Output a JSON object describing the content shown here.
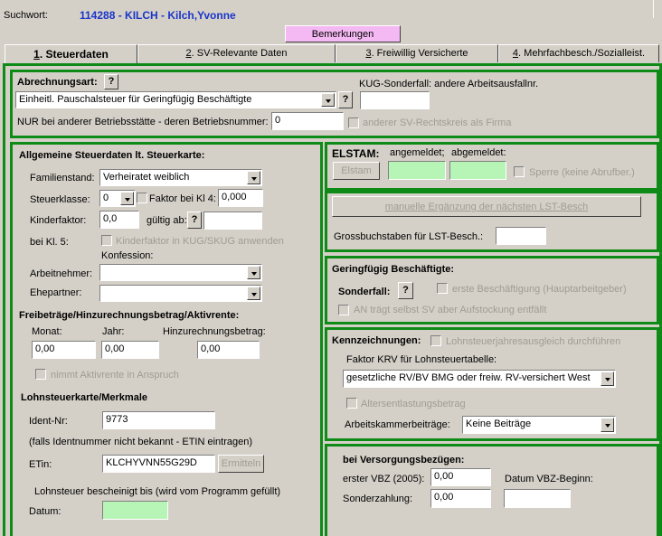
{
  "header": {
    "suchwort_label": "Suchwort:",
    "suchwort_value": "114288 - KILCH - Kilch,Yvonne",
    "bemerkungen": "Bemerkungen"
  },
  "tabs": [
    {
      "num": "1",
      "label": ". Steuerdaten"
    },
    {
      "num": "2",
      "label": ". SV-Relevante Daten"
    },
    {
      "num": "3",
      "label": ". Freiwillig Versicherte"
    },
    {
      "num": "4",
      "label": ". Mehrfachbesch./Sozialleist."
    }
  ],
  "abrechnung": {
    "title": "Abrechnungsart:",
    "help": "?",
    "select_value": "Einheitl. Pauschalsteuer für Geringfügig Beschäftigte",
    "help2": "?",
    "kug_label": "KUG-Sonderfall: andere Arbeitsausfallnr.",
    "kug_value": "",
    "betrieb_label": "NUR bei anderer Betriebsstätte - deren Betriebsnummer:",
    "betrieb_value": "0",
    "sv_rechtskreis": "anderer SV-Rechtskreis als Firma"
  },
  "steuerdaten": {
    "title": "Allgemeine Steuerdaten lt. Steuerkarte:",
    "familienstand_label": "Familienstand:",
    "familienstand_value": "Verheiratet weiblich",
    "steuerklasse_label": "Steuerklasse:",
    "steuerklasse_value": "0",
    "faktor_label": "Faktor bei Kl 4:",
    "faktor_value": "0,000",
    "kinderfaktor_label": "Kinderfaktor:",
    "kinderfaktor_value": "0,0",
    "gueltig_label": "gültig ab:",
    "gueltig_help": "?",
    "gueltig_value": "",
    "kl5_label": "bei Kl. 5:",
    "kl5_check": "Kinderfaktor in KUG/SKUG anwenden",
    "konfession_label": "Konfession:",
    "arbeitnehmer_label": "Arbeitnehmer:",
    "arbeitnehmer_value": "",
    "ehepartner_label": "Ehepartner:",
    "ehepartner_value": ""
  },
  "freibetraege": {
    "title": "Freibeträge/Hinzurechnungsbetrag/Aktivrente:",
    "monat_label": "Monat:",
    "jahr_label": "Jahr:",
    "hinzu_label": "Hinzurechnungsbetrag:",
    "monat_value": "0,00",
    "jahr_value": "0,00",
    "hinzu_value": "0,00",
    "aktivrente": "nimmt Aktivrente in Anspruch"
  },
  "lohnsteuerkarte": {
    "title": "Lohnsteuerkarte/Merkmale",
    "ident_label": "Ident-Nr:",
    "ident_value": "9773",
    "etin_hint": "(falls Identnummer nicht bekannt - ETIN eintragen)",
    "etin_label": "ETin:",
    "etin_value": "KLCHYVNN55G29D",
    "ermitteln": "Ermitteln",
    "bescheinigt": "Lohnsteuer bescheinigt bis (wird vom Programm gefüllt)",
    "datum_label": "Datum:",
    "datum_value": ""
  },
  "elstam": {
    "title": "ELSTAM:",
    "angemeldet": "angemeldet;",
    "abgemeldet": "abgemeldet:",
    "button": "Elstam",
    "angemeldet_value": "",
    "abgemeldet_value": "",
    "sperre": "Sperre (keine Abrufber.)"
  },
  "manuell": {
    "button": "manuelle Ergänzung der nächsten LST-Besch",
    "gross_label": "Grossbuchstaben für LST-Besch.:",
    "gross_value": ""
  },
  "geringfuegig": {
    "title": "Geringfügig Beschäftigte:",
    "sonderfall": "Sonderfall:",
    "help": "?",
    "erste": "erste Beschäftigung (Hauptarbeitgeber)",
    "an_traegt": "AN trägt selbst SV aber Aufstockung entfällt"
  },
  "kennzeichnungen": {
    "title": "Kennzeichnungen:",
    "jahresausgleich": "Lohnsteuerjahresausgleich durchführen",
    "krv_label": "Faktor KRV für Lohnsteuertabelle:",
    "krv_value": "gesetzliche RV/BV BMG oder freiw. RV-versichert West",
    "altersentlastung": "Altersentlastungsbetrag",
    "kammer_label": "Arbeitskammerbeiträge:",
    "kammer_value": "Keine Beiträge"
  },
  "versorgung": {
    "title": "bei Versorgungsbezügen:",
    "vbz_label": "erster VBZ (2005):",
    "vbz_value": "0,00",
    "datum_label": "Datum VBZ-Beginn:",
    "datum_value": "",
    "sonder_label": "Sonderzahlung:",
    "sonder_value": "0,00"
  }
}
